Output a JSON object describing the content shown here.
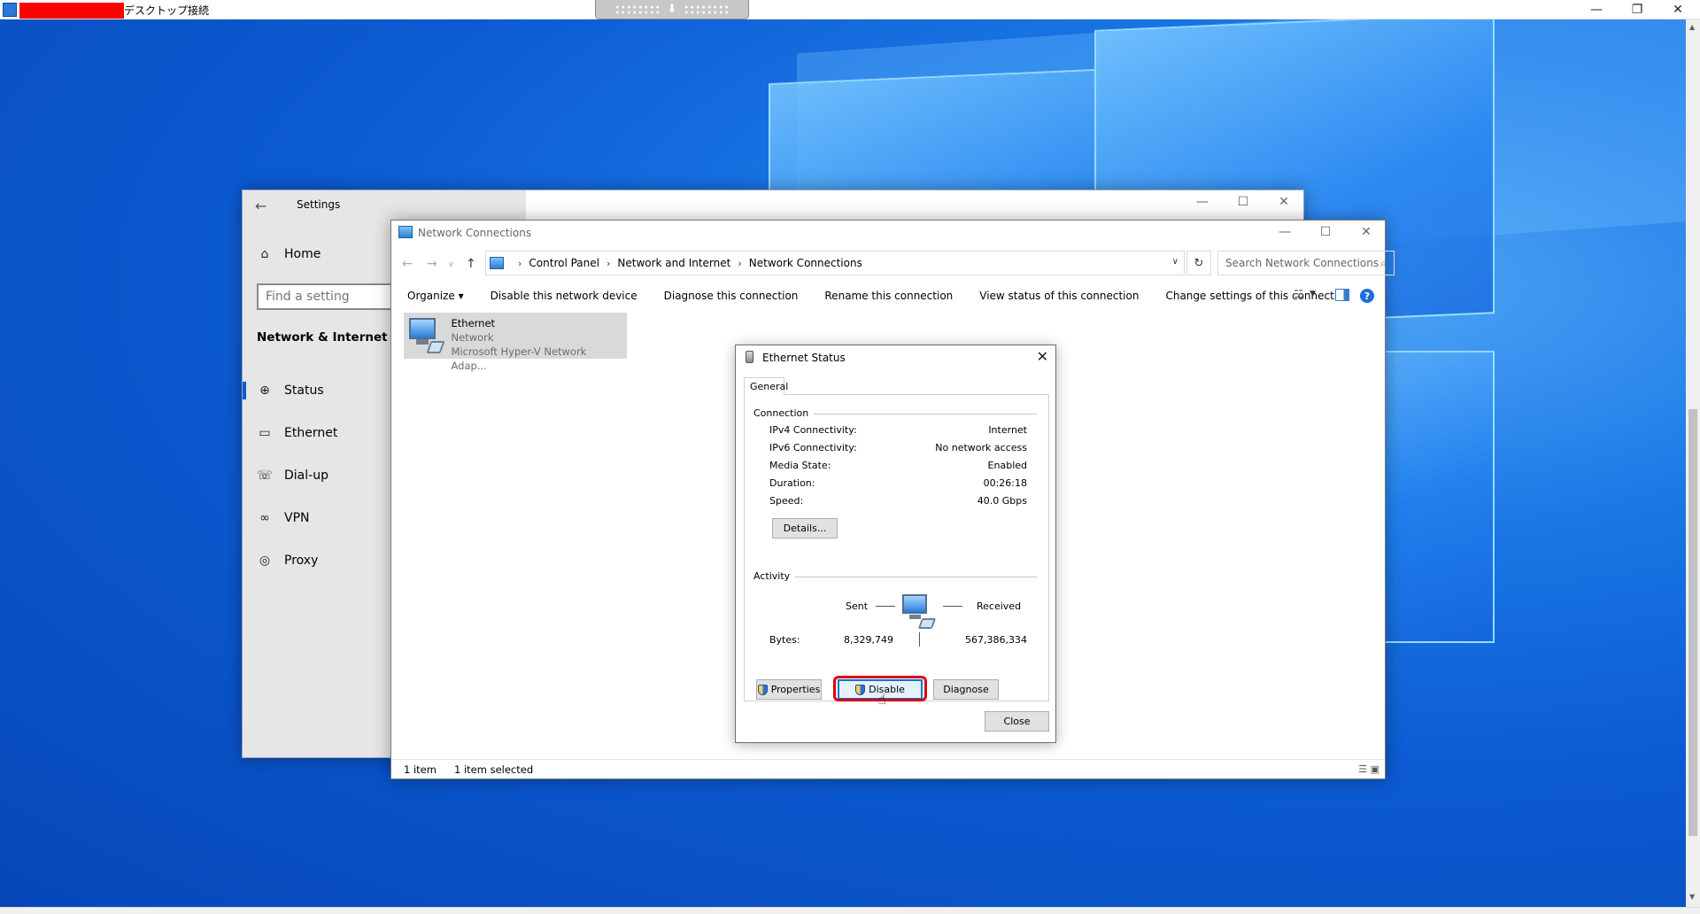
{
  "rdp": {
    "title": "デスクトップ接続",
    "controls": {
      "minimize": "—",
      "restore": "❐",
      "close": "✕"
    }
  },
  "settings": {
    "title": "Settings",
    "back_icon": "arrow-left-icon",
    "home_label": "Home",
    "search_placeholder": "Find a setting",
    "section_title": "Network & Internet",
    "nav_items": [
      {
        "label": "Status",
        "icon": "globe-status-icon",
        "active": true
      },
      {
        "label": "Ethernet",
        "icon": "ethernet-icon",
        "active": false
      },
      {
        "label": "Dial-up",
        "icon": "dialup-icon",
        "active": false
      },
      {
        "label": "VPN",
        "icon": "vpn-icon",
        "active": false
      },
      {
        "label": "Proxy",
        "icon": "globe-icon",
        "active": false
      }
    ]
  },
  "netconn": {
    "title": "Network Connections",
    "breadcrumb": [
      "Control Panel",
      "Network and Internet",
      "Network Connections"
    ],
    "search_placeholder": "Search Network Connections",
    "toolbar": {
      "organize": "Organize",
      "disable": "Disable this network device",
      "diagnose": "Diagnose this connection",
      "rename": "Rename this connection",
      "view_status": "View status of this connection",
      "change_settings": "Change settings of this connection"
    },
    "item": {
      "name": "Ethernet",
      "network": "Network",
      "adapter": "Microsoft Hyper-V Network Adap..."
    },
    "status": {
      "count": "1 item",
      "selected": "1 item selected"
    }
  },
  "dialog": {
    "title": "Ethernet Status",
    "tab": "General",
    "connection_label": "Connection",
    "rows": [
      {
        "label": "IPv4 Connectivity:",
        "value": "Internet"
      },
      {
        "label": "IPv6 Connectivity:",
        "value": "No network access"
      },
      {
        "label": "Media State:",
        "value": "Enabled"
      },
      {
        "label": "Duration:",
        "value": "00:26:18"
      },
      {
        "label": "Speed:",
        "value": "40.0 Gbps"
      }
    ],
    "details_button": "Details...",
    "activity_label": "Activity",
    "sent_label": "Sent",
    "received_label": "Received",
    "bytes_label": "Bytes:",
    "bytes_sent": "8,329,749",
    "bytes_received": "567,386,334",
    "properties_button": "Properties",
    "disable_button": "Disable",
    "diagnose_button": "Diagnose",
    "close_button": "Close"
  },
  "colors": {
    "accent": "#0a5bd6",
    "highlight": "#e00000",
    "selection": "#d9d9d9"
  }
}
